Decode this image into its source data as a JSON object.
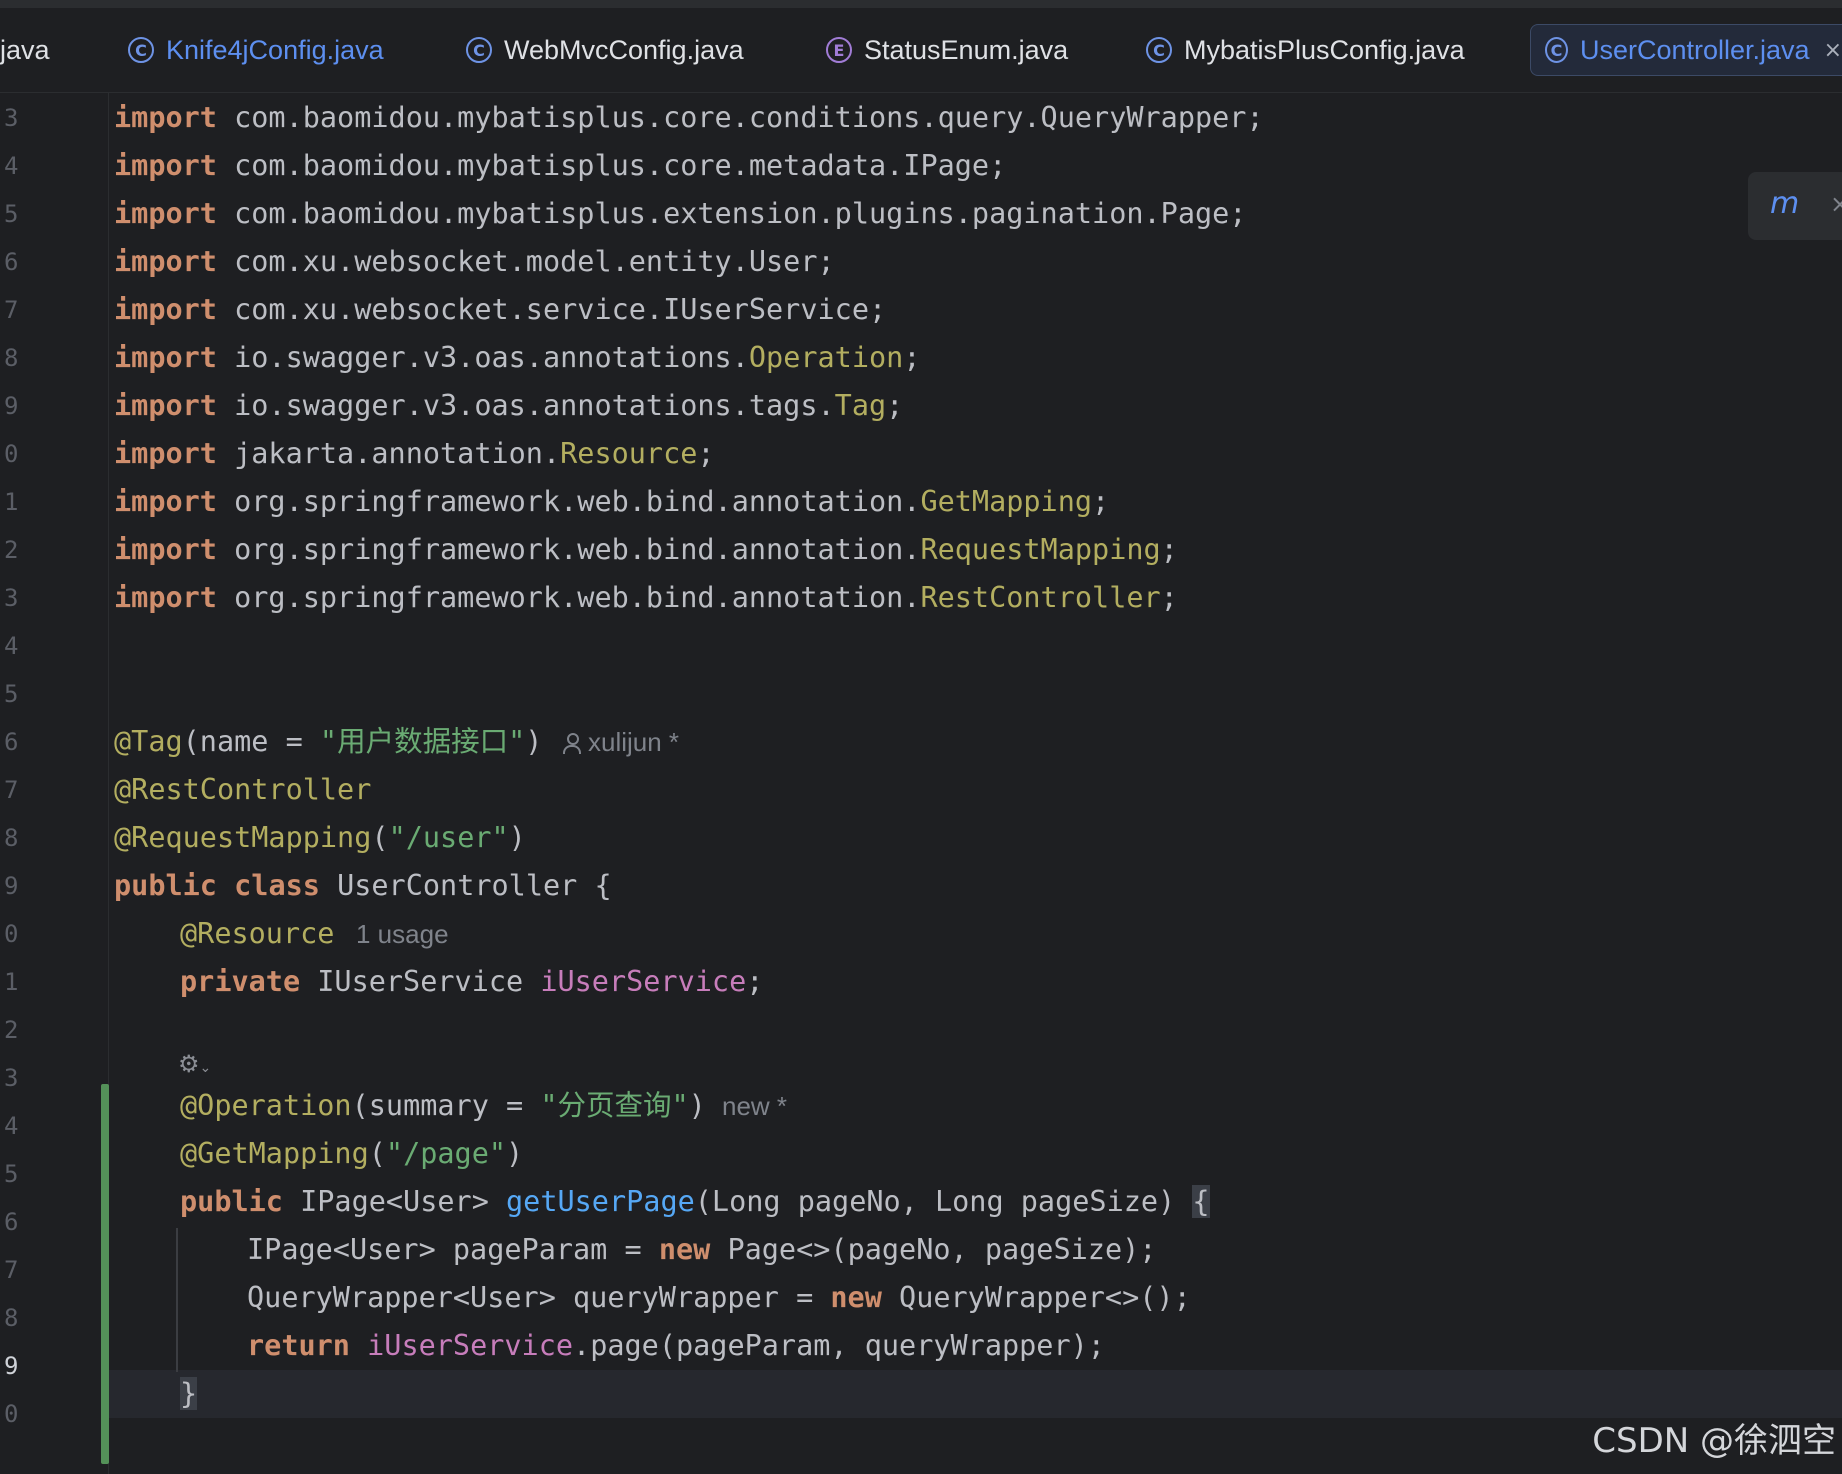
{
  "tabs": {
    "partial": "java",
    "t1": "Knife4jConfig.java",
    "t2": "WebMvcConfig.java",
    "t3": "StatusEnum.java",
    "t4": "MybatisPlusConfig.java",
    "t5": "UserController.java"
  },
  "line_numbers": [
    "3",
    "4",
    "5",
    "6",
    "7",
    "8",
    "9",
    "0",
    "1",
    "2",
    "3",
    "4",
    "5",
    "6",
    "7",
    "8",
    "9",
    "0",
    "1",
    "2",
    "3",
    "4",
    "5",
    "6",
    "7",
    "8",
    "9",
    "0"
  ],
  "code": {
    "kw_import": "import",
    "l3": " com.baomidou.mybatisplus.core.conditions.query.QueryWrapper;",
    "l4": " com.baomidou.mybatisplus.core.metadata.IPage;",
    "l5": " com.baomidou.mybatisplus.extension.plugins.pagination.Page;",
    "l6": " com.xu.websocket.model.entity.User;",
    "l7": " com.xu.websocket.service.IUserService;",
    "l8a": " io.swagger.v3.oas.annotations.",
    "l8b": "Operation",
    "l9a": " io.swagger.v3.oas.annotations.tags.",
    "l9b": "Tag",
    "l10a": " jakarta.annotation.",
    "l10b": "Resource",
    "l11a": " org.springframework.web.bind.annotation.",
    "l11b": "GetMapping",
    "l12a": " org.springframework.web.bind.annotation.",
    "l12b": "RequestMapping",
    "l13a": " org.springframework.web.bind.annotation.",
    "l13b": "RestController",
    "semi": ";",
    "tag_ann": "@Tag",
    "tag_open": "(name = ",
    "tag_str": "\"用户数据接口\"",
    "close_paren": ")",
    "rest_ann": "@RestController",
    "req_ann": "@RequestMapping",
    "open_paren": "(",
    "req_str": "\"/user\"",
    "kw_public": "public",
    "kw_class": "class",
    "class_decl": " UserController {",
    "res_ann": "@Resource",
    "kw_private": "private",
    "field_type": " IUserService ",
    "field_name": "iUserService",
    "op_ann": "@Operation",
    "op_open": "(summary = ",
    "op_str": "\"分页查询\"",
    "get_ann": "@GetMapping",
    "get_str": "\"/page\"",
    "method_ret": " IPage<User> ",
    "method_name": "getUserPage",
    "method_params": "(Long pageNo, Long pageSize) ",
    "brace_open": "{",
    "l26a": "IPage<User> pageParam = ",
    "kw_new": "new",
    "l26b": " Page<>(pageNo, pageSize);",
    "l27a": "QueryWrapper<User> queryWrapper = ",
    "l27b": " QueryWrapper<>();",
    "kw_return": "return",
    "l28b": ".page(pageParam, queryWrapper);",
    "brace_close": "}"
  },
  "hints": {
    "author": "xulijun *",
    "usage": "1 usage",
    "new_mark": "new *"
  },
  "watermark": "CSDN @徐泗空"
}
